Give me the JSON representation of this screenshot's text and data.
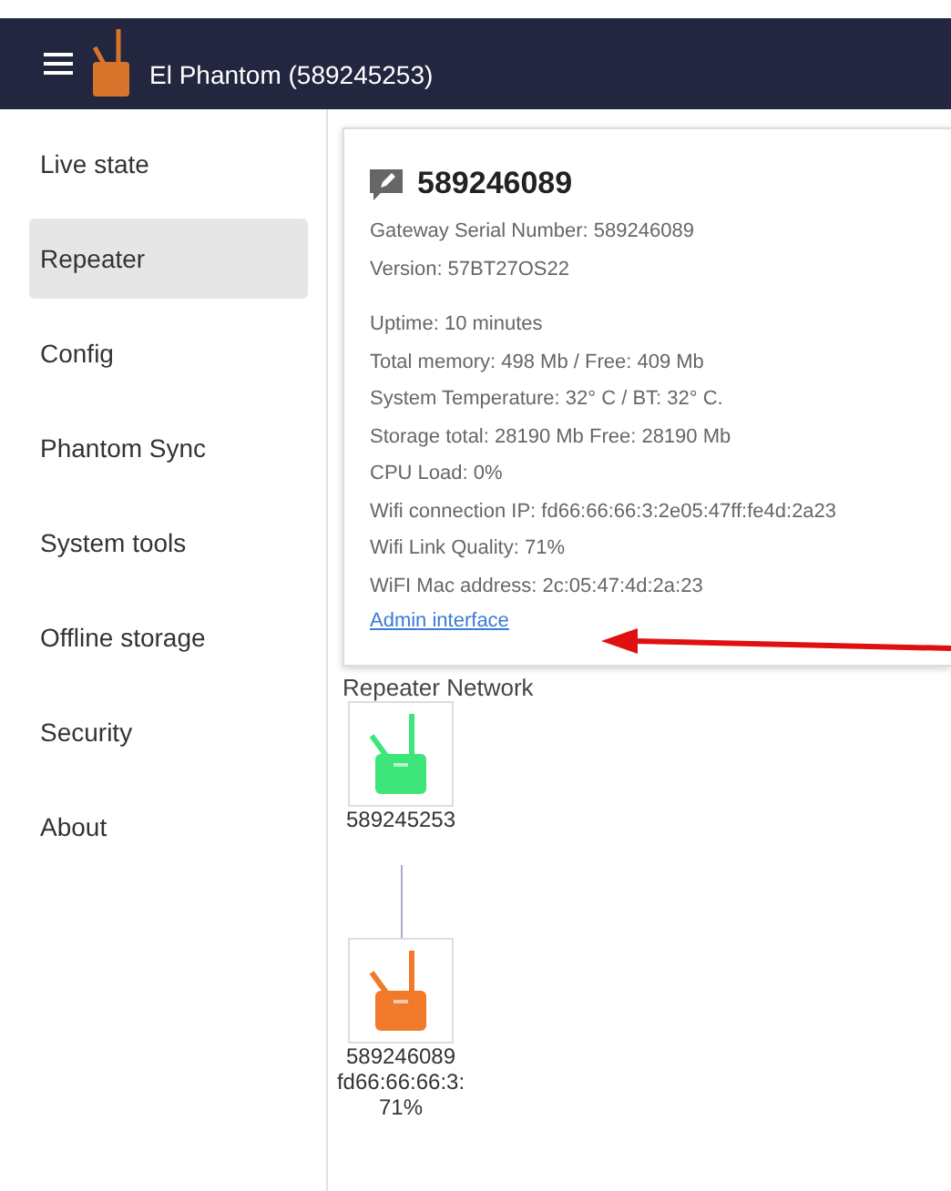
{
  "header": {
    "title": "El Phantom (589245253)"
  },
  "sidebar": {
    "items": [
      {
        "label": "Live state",
        "selected": false
      },
      {
        "label": "Repeater",
        "selected": true
      },
      {
        "label": "Config",
        "selected": false
      },
      {
        "label": "Phantom Sync",
        "selected": false
      },
      {
        "label": "System tools",
        "selected": false
      },
      {
        "label": "Offline storage",
        "selected": false
      },
      {
        "label": "Security",
        "selected": false
      },
      {
        "label": "About",
        "selected": false
      }
    ]
  },
  "card": {
    "title": "589246089",
    "info": [
      "Gateway Serial Number: 589246089",
      "Version: 57BT27OS22"
    ],
    "stats": [
      "Uptime: 10 minutes",
      "Total memory: 498 Mb / Free: 409 Mb",
      "System Temperature: 32° C / BT: 32° C.",
      "Storage total: 28190 Mb Free: 28190 Mb",
      "CPU Load: 0%",
      "Wifi connection IP: fd66:66:66:3:2e05:47ff:fe4d:2a23",
      "Wifi Link Quality: 71%",
      "WiFI Mac address: 2c:05:47:4d:2a:23"
    ],
    "link": "Admin interface"
  },
  "network": {
    "title": "Repeater Network",
    "nodes": [
      {
        "lines": [
          "589245253"
        ],
        "color": "#3ee67a"
      },
      {
        "lines": [
          "589246089",
          "fd66:66:66:3:",
          "71%"
        ],
        "color": "#f07a2a"
      }
    ]
  }
}
